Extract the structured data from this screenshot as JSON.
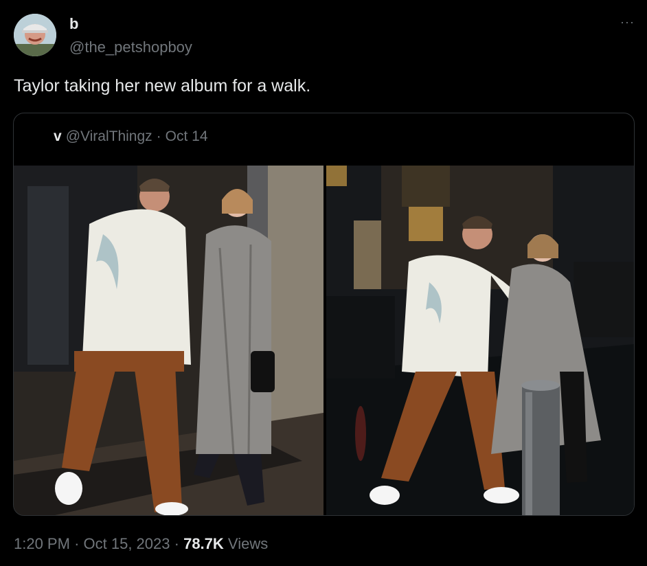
{
  "author": {
    "display_name": "b",
    "handle": "@the_petshopboy",
    "avatar_icon": "avatar-photo"
  },
  "more_icon": "···",
  "tweet": {
    "text": "Taylor taking her new album for a walk."
  },
  "quote": {
    "author_name": "v",
    "handle": "@ViralThingz",
    "separator": "·",
    "date": "Oct 14",
    "photos": [
      {
        "description_icon": "photo-couple-walking-indoor"
      },
      {
        "description_icon": "photo-couple-walking-street-night"
      }
    ]
  },
  "footer": {
    "time": "1:20 PM",
    "separator": "·",
    "date": "Oct 15, 2023",
    "views_count": "78.7K",
    "views_label": "Views"
  },
  "colors": {
    "background": "#000000",
    "text_primary": "#e7e9ea",
    "text_secondary": "#71767b",
    "border": "#2f3336"
  }
}
